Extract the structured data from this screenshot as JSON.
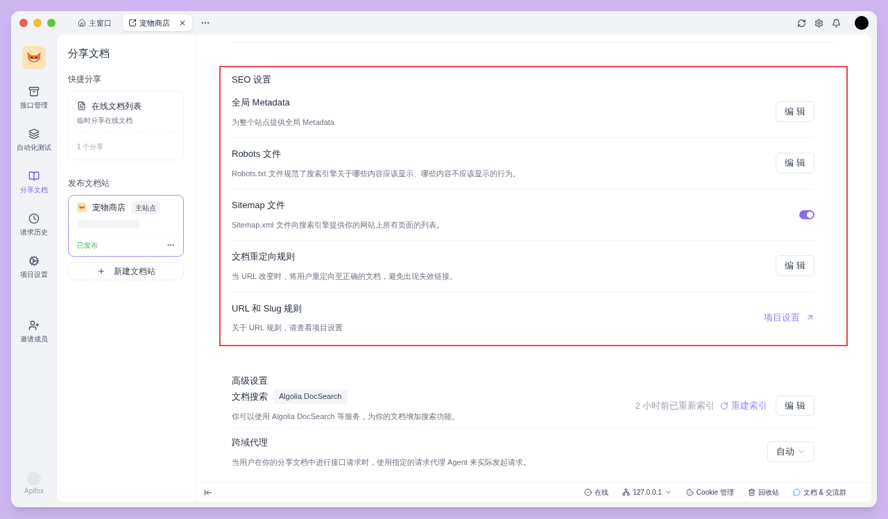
{
  "tabs": [
    {
      "label": "主窗口",
      "kind": "home",
      "selected": false
    },
    {
      "label": "宠物商店",
      "kind": "doc",
      "selected": true
    }
  ],
  "nav": {
    "items": [
      {
        "label": "接口管理",
        "kind": "api",
        "selected": false
      },
      {
        "label": "自动化测试",
        "kind": "test",
        "selected": false
      },
      {
        "label": "分享文档",
        "kind": "docs",
        "selected": true
      },
      {
        "label": "请求历史",
        "kind": "history",
        "selected": false
      },
      {
        "label": "项目设置",
        "kind": "settings",
        "selected": false
      }
    ],
    "invite": "邀请成员",
    "brand": "Apifox"
  },
  "share_panel": {
    "title": "分享文档",
    "quick_title": "快捷分享",
    "quick_card": {
      "title": "在线文档列表",
      "subtitle": "临时分享在线文档",
      "count": "1 个分享"
    },
    "sites_title": "发布文档站",
    "site_card": {
      "name": "宠物商店",
      "tag": "主站点",
      "status": "已发布",
      "selected": true
    },
    "new_site": "新建文档站"
  },
  "seo": {
    "title": "SEO 设置",
    "rows": [
      {
        "kind": "button",
        "title": "全局 Metadata",
        "desc": "为整个站点提供全局 Metadata",
        "action": "编 辑"
      },
      {
        "kind": "button",
        "title": "Robots 文件",
        "desc": "Robots.txt 文件规范了搜索引擎关于哪些内容应该显示、哪些内容不应该显示的行为。",
        "action": "编 辑"
      },
      {
        "kind": "toggle",
        "title": "Sitemap 文件",
        "desc": "Sitemap.xml 文件向搜索引擎提供你的网站上所有页面的列表。",
        "on": true
      },
      {
        "kind": "button",
        "title": "文档重定向规则",
        "desc": "当 URL 改变时，将用户重定向至正确的文档，避免出现失效链接。",
        "action": "编 辑"
      },
      {
        "kind": "link",
        "title": "URL 和 Slug 规则",
        "desc": "关于 URL 规则，请查看项目设置",
        "action": "项目设置"
      }
    ]
  },
  "advanced": {
    "title": "高级设置",
    "rows": [
      {
        "kind": "search",
        "title": "文档搜索",
        "tag": "Algolia DocSearch",
        "desc": "你可以使用 Algolia DocSearch 等服务，为你的文档增加搜索功能。",
        "note": "2 小时前已重新索引",
        "link": "重建索引",
        "action": "编 辑"
      },
      {
        "kind": "select",
        "title": "跨域代理",
        "desc": "当用户在你的分享文档中进行接口请求时，使用指定的请求代理 Agent 来实际发起请求。",
        "value": "自动"
      }
    ]
  },
  "status_bar": {
    "online": "在线",
    "host": "127.0.0.1",
    "cookie": "Cookie 管理",
    "trash": "回收站",
    "community": "文档 & 交流群"
  }
}
